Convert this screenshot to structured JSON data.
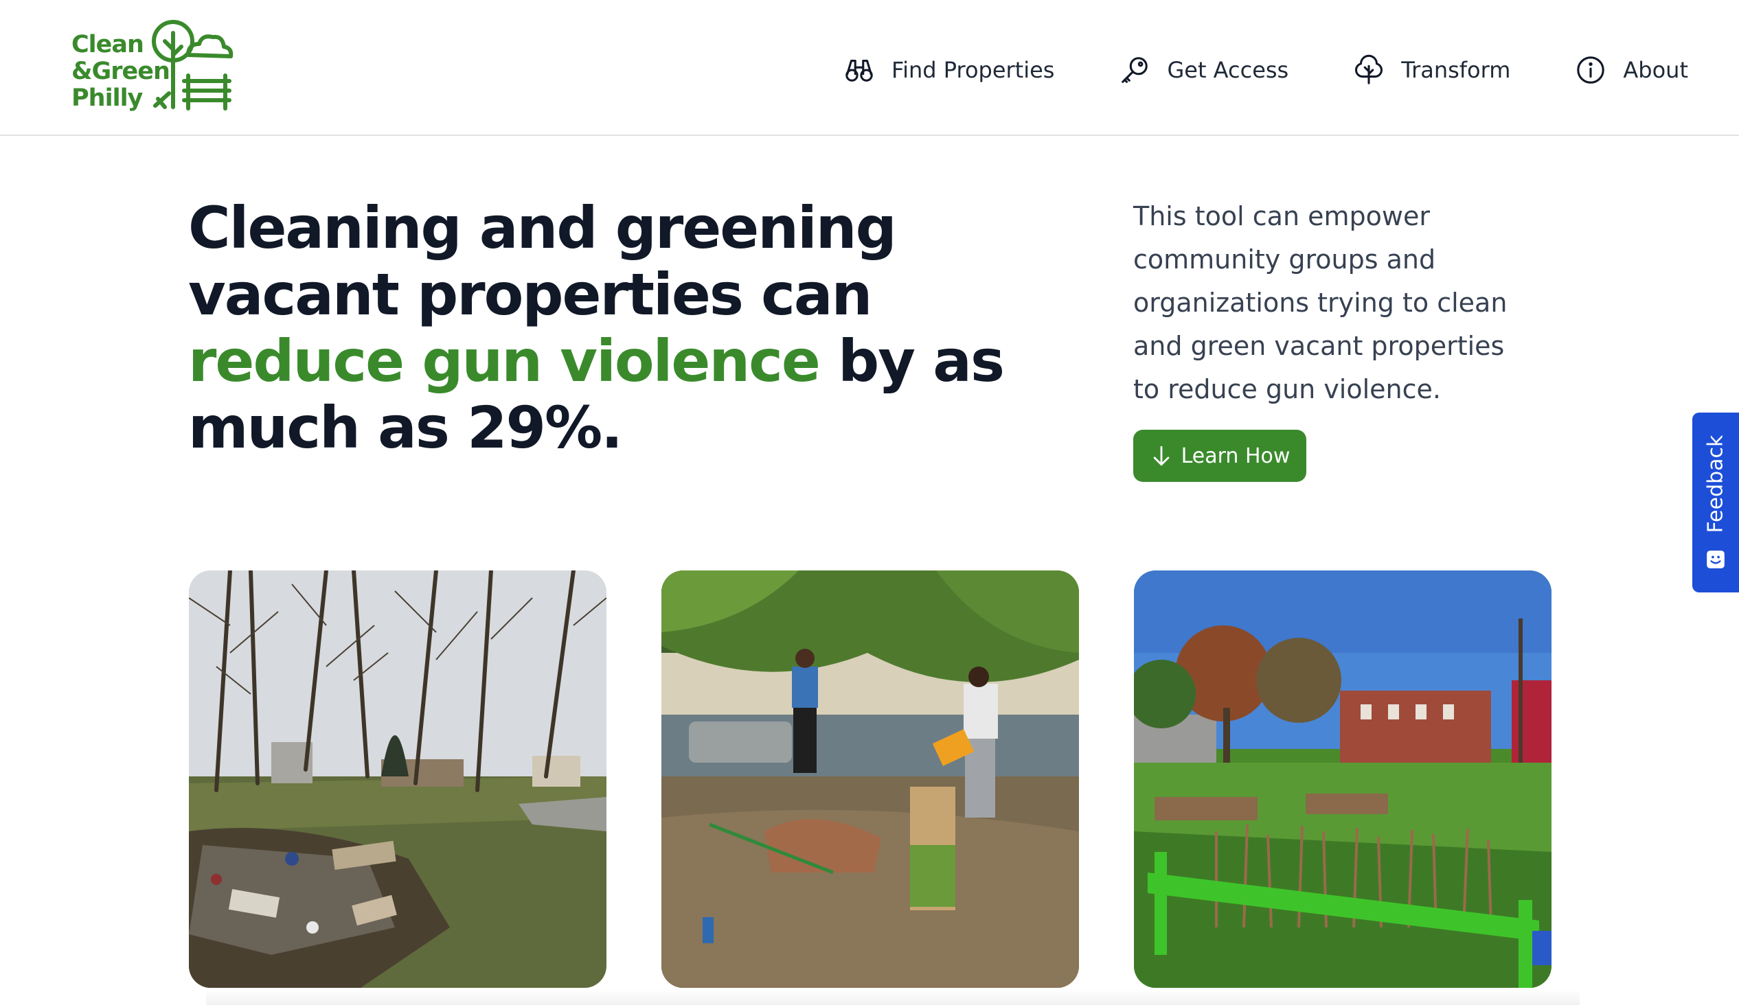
{
  "header": {
    "logo": {
      "line1": "Clean",
      "line2": "&Green",
      "line3": "Philly"
    },
    "nav": [
      {
        "label": "Find Properties",
        "icon": "binoculars-icon"
      },
      {
        "label": "Get Access",
        "icon": "key-icon"
      },
      {
        "label": "Transform",
        "icon": "tree-icon"
      },
      {
        "label": "About",
        "icon": "info-icon"
      }
    ]
  },
  "hero": {
    "headline_part1": "Cleaning and greening vacant properties can ",
    "headline_highlight": "reduce gun violence",
    "headline_part2": " by as much as 29%.",
    "intro": "This tool can empower community groups and organizations trying to clean and green vacant properties to reduce gun violence.",
    "cta_label": "Learn How"
  },
  "feedback": {
    "label": "Feedback"
  },
  "colors": {
    "brand_green": "#3a8a2c",
    "feedback_blue": "#1d4ed8",
    "text_dark": "#111827"
  },
  "photos": [
    {
      "name": "vacant-lot-before-photo"
    },
    {
      "name": "volunteers-cleaning-photo"
    },
    {
      "name": "greened-lot-after-photo"
    }
  ]
}
